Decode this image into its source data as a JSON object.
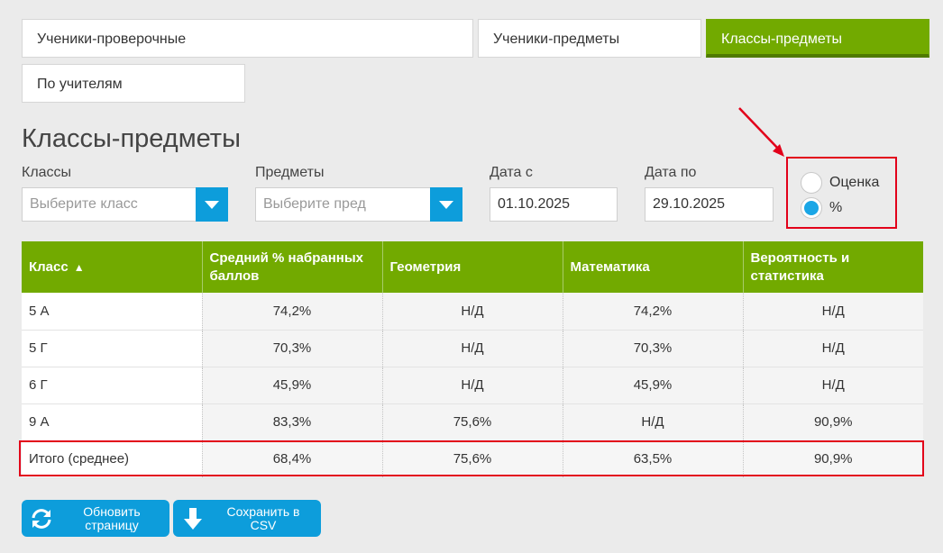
{
  "tabs": [
    {
      "label": "Ученики-проверочные",
      "active": false
    },
    {
      "label": "Ученики-предметы",
      "active": false
    },
    {
      "label": "Классы-предметы",
      "active": true
    },
    {
      "label": "По учителям",
      "active": false
    }
  ],
  "page_title": "Классы-предметы",
  "filters": {
    "classes_label": "Классы",
    "classes_placeholder": "Выберите класс",
    "subjects_label": "Предметы",
    "subjects_placeholder": "Выберите пред",
    "date_from_label": "Дата с",
    "date_from_value": "01.10.2025",
    "date_to_label": "Дата по",
    "date_to_value": "29.10.2025"
  },
  "view_mode": {
    "options": [
      {
        "label": "Оценка",
        "selected": false
      },
      {
        "label": "%",
        "selected": true
      }
    ]
  },
  "table": {
    "headers": [
      "Класс",
      "Средний % набранных баллов",
      "Геометрия",
      "Математика",
      "Вероятность и статистика"
    ],
    "sort_indicator": "▲",
    "rows": [
      [
        "5 А",
        "74,2%",
        "Н/Д",
        "74,2%",
        "Н/Д"
      ],
      [
        "5 Г",
        "70,3%",
        "Н/Д",
        "70,3%",
        "Н/Д"
      ],
      [
        "6 Г",
        "45,9%",
        "Н/Д",
        "45,9%",
        "Н/Д"
      ],
      [
        "9 А",
        "83,3%",
        "75,6%",
        "Н/Д",
        "90,9%"
      ]
    ],
    "total": [
      "Итого (среднее)",
      "68,4%",
      "75,6%",
      "63,5%",
      "90,9%"
    ]
  },
  "buttons": {
    "refresh_label": "Обновить страницу",
    "csv_label": "Сохранить в CSV"
  },
  "colors": {
    "accent_green": "#72aa00",
    "accent_blue": "#0d9ddb",
    "annotation_red": "#e2001a"
  },
  "icons": {
    "refresh": "refresh-icon",
    "download": "download-arrow-icon",
    "dropdown": "chevron-down-icon"
  }
}
